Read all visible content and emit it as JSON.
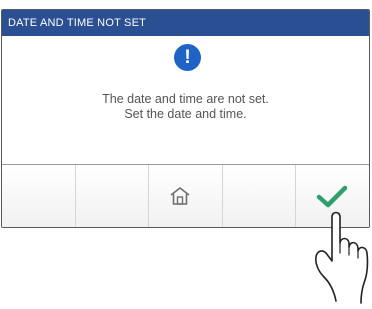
{
  "dialog": {
    "title": "DATE AND TIME NOT SET",
    "message_line1": "The date and time are not set.",
    "message_line2": "Set the date and time."
  },
  "colors": {
    "title_bar": "#2a4f93",
    "alert_icon": "#1f63c6",
    "confirm_check": "#2ea06f"
  },
  "icons": {
    "alert": "exclamation-circle-icon",
    "home": "home-icon",
    "confirm": "checkmark-icon",
    "hand": "pointing-hand-icon"
  },
  "glyphs": {
    "alert": "!"
  }
}
